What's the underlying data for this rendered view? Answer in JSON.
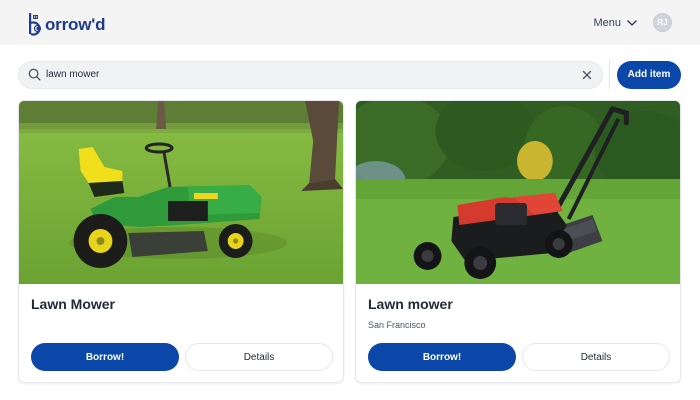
{
  "app": {
    "logo_text": "orrow'd",
    "logo_icon": "robot-b-icon",
    "brand_color": "#1e3a8a"
  },
  "header": {
    "menu_label": "Menu",
    "avatar_initials": "RJ"
  },
  "search": {
    "value": "lawn mower",
    "placeholder": ""
  },
  "toolbar": {
    "add_item_label": "Add item"
  },
  "colors": {
    "accent": "#0b47a8",
    "page_bg": "#f4f4f5"
  },
  "items": [
    {
      "title": "Lawn Mower",
      "location": "",
      "image": "green riding lawn tractor on grass",
      "borrow_label": "Borrow!",
      "details_label": "Details"
    },
    {
      "title": "Lawn mower",
      "location": "San Francisco",
      "image": "red and black push lawn mower on grass",
      "borrow_label": "Borrow!",
      "details_label": "Details"
    }
  ]
}
